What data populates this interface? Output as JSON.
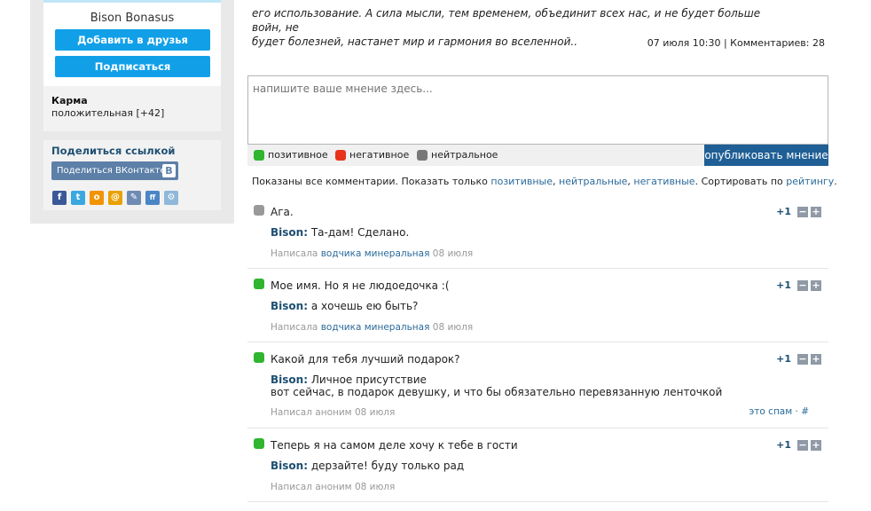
{
  "profile": {
    "name": "Bison Bonasus",
    "add_friend_label": "Добавить в друзья",
    "subscribe_label": "Подписаться",
    "karma_label": "Карма",
    "karma_value": "положительная [+42]"
  },
  "share": {
    "title": "Поделиться ссылкой",
    "vk_label": "Поделиться ВКонтакте",
    "vk_badge": "В",
    "icons": [
      {
        "name": "facebook-icon",
        "glyph": "f",
        "color": "#3b5998"
      },
      {
        "name": "twitter-icon",
        "glyph": "t",
        "color": "#3aa8e0"
      },
      {
        "name": "odnoklassniki-icon",
        "glyph": "o",
        "color": "#f29400"
      },
      {
        "name": "mailru-icon",
        "glyph": "@",
        "color": "#e8a100"
      },
      {
        "name": "livejournal-icon",
        "glyph": "✎",
        "color": "#6e8cb3"
      },
      {
        "name": "friendfeed-icon",
        "glyph": "ff",
        "color": "#4a86c5"
      },
      {
        "name": "bookmark-icon",
        "glyph": "⚙",
        "color": "#8fb7d9"
      }
    ]
  },
  "post": {
    "text_line1": "его использование. А сила мысли, тем временем, объединит всех нас, и не будет больше войн, не",
    "text_line2": "будет болезней, настанет мир и гармония во вселенной..",
    "meta": "07 июля 10:30 | Комментариев: 28"
  },
  "comment_form": {
    "placeholder": "напишите ваше мнение здесь...",
    "tones": [
      {
        "label": "позитивное",
        "color": "#2fb52f"
      },
      {
        "label": "негативное",
        "color": "#e8321a"
      },
      {
        "label": "нейтральное",
        "color": "#777777"
      }
    ],
    "publish_label": "опубликовать мнение"
  },
  "filter": {
    "prefix": "Показаны все комментарии. Показать только ",
    "positive": "позитивные",
    "sep1": ", ",
    "neutral": "нейтральные",
    "sep2": ", ",
    "negative": "негативные",
    "middle": ". Сортировать по ",
    "rating": "рейтингу",
    "suffix": "."
  },
  "colors": {
    "positive": "#2fb52f",
    "neutral": "#999999",
    "negative": "#e8321a",
    "accent": "#11a0e8",
    "publish": "#1f5f95"
  },
  "comments": [
    {
      "tone": "neutral",
      "text": "Ага.",
      "author_reply_name": "Bison:",
      "reply_lines": [
        "Та-дам! Сделано."
      ],
      "meta_prefix": "Написала ",
      "meta_author": "водчика минеральная",
      "meta_date": " 08 июля",
      "score": "+1"
    },
    {
      "tone": "positive",
      "text": "Мое имя. Но я не людоедочка :(",
      "author_reply_name": "Bison:",
      "reply_lines": [
        "а хочешь ею быть?"
      ],
      "meta_prefix": "Написала ",
      "meta_author": "водчика минеральная",
      "meta_date": " 08 июля",
      "score": "+1"
    },
    {
      "tone": "positive",
      "text": "Какой для тебя лучший подарок?",
      "author_reply_name": "Bison:",
      "reply_lines": [
        "Личное присутствие",
        "вот сейчас, в подарок девушку, и что бы обязательно перевязанную ленточкой"
      ],
      "meta_prefix": "Написал аноним 08 июля",
      "meta_author": "",
      "meta_date": "",
      "spam": "это спам",
      "anchor": "#",
      "score": "+1"
    },
    {
      "tone": "positive",
      "text": "Теперь я на самом деле хочу к тебе в гости",
      "author_reply_name": "Bison:",
      "reply_lines": [
        "дерзайте! буду только рад"
      ],
      "meta_prefix": "Написал аноним 08 июля",
      "meta_author": "",
      "meta_date": "",
      "score": "+1"
    }
  ],
  "vote": {
    "minus": "−",
    "plus": "+"
  }
}
